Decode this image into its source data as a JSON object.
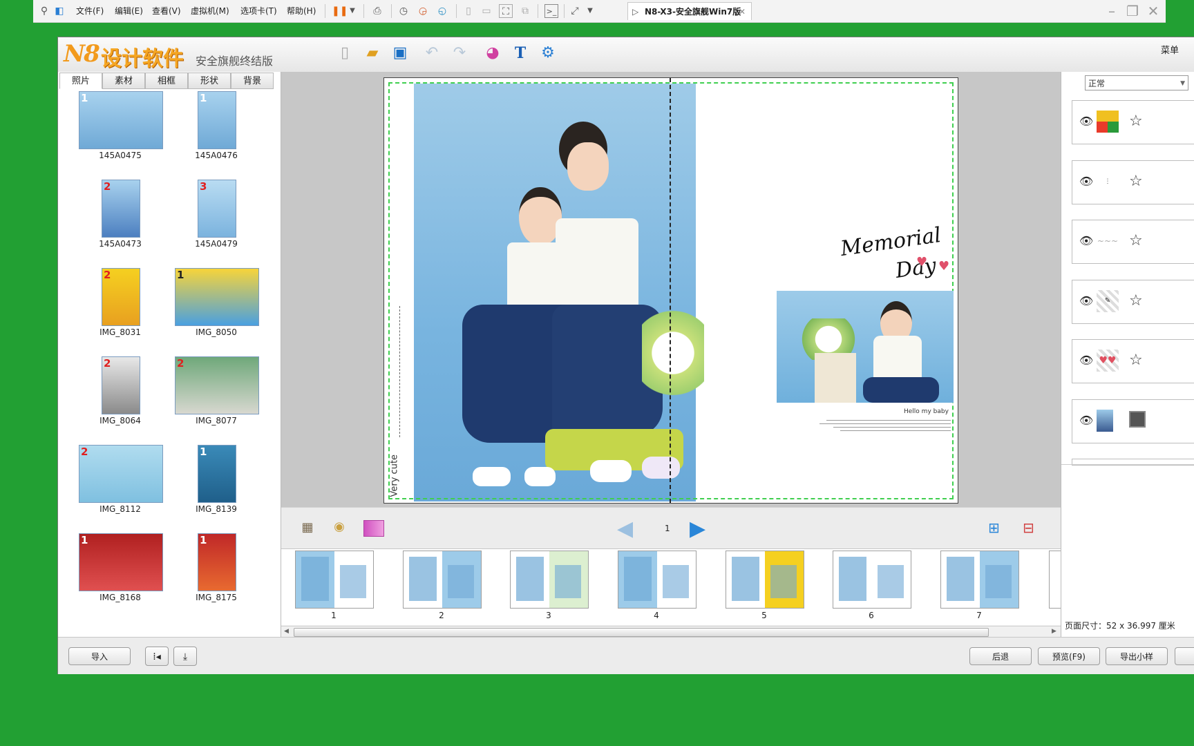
{
  "vm_toolbar": {
    "menus": [
      "文件(F)",
      "编辑(E)",
      "查看(V)",
      "虚拟机(M)",
      "选项卡(T)",
      "帮助(H)"
    ],
    "tab_title": "N8-X3-安全旗舰Win7版"
  },
  "app": {
    "logo_brand": "N8",
    "logo_title": "设计软件",
    "logo_subtitle": "安全旗舰终结版",
    "menu_label": "菜单"
  },
  "left_tabs": [
    "照片",
    "素材",
    "相框",
    "形状",
    "背景"
  ],
  "photos": [
    {
      "name": "145A0475",
      "badge": "1",
      "badge_color": "#ffffff"
    },
    {
      "name": "145A0476",
      "badge": "1",
      "badge_color": "#ffffff"
    },
    {
      "name": "145A0473",
      "badge": "2",
      "badge_color": "#e02020"
    },
    {
      "name": "145A0479",
      "badge": "3",
      "badge_color": "#e02020"
    },
    {
      "name": "IMG_8031",
      "badge": "2",
      "badge_color": "#e02020"
    },
    {
      "name": "IMG_8050",
      "badge": "1",
      "badge_color": "#222222"
    },
    {
      "name": "IMG_8064",
      "badge": "2",
      "badge_color": "#e02020"
    },
    {
      "name": "IMG_8077",
      "badge": "2",
      "badge_color": "#e02020"
    },
    {
      "name": "IMG_8112",
      "badge": "2",
      "badge_color": "#e02020"
    },
    {
      "name": "IMG_8139",
      "badge": "1",
      "badge_color": "#ffffff"
    },
    {
      "name": "IMG_8168",
      "badge": "1",
      "badge_color": "#ffffff"
    },
    {
      "name": "IMG_8175",
      "badge": "1",
      "badge_color": "#ffffff"
    }
  ],
  "canvas": {
    "vertical_text": "Very cute",
    "memorial_line1": "Memorial",
    "memorial_line2": "Day",
    "caption_title": "Hello my baby"
  },
  "pager": {
    "current_page": "1"
  },
  "film_pages": [
    "1",
    "2",
    "3",
    "4",
    "5",
    "6",
    "7"
  ],
  "right_panel": {
    "blend_mode": "正常",
    "page_size": "页面尺寸：52 x 36.997 厘米"
  },
  "bottom": {
    "import": "导入",
    "back": "后退",
    "preview": "预览(F9)",
    "export": "导出小样"
  }
}
